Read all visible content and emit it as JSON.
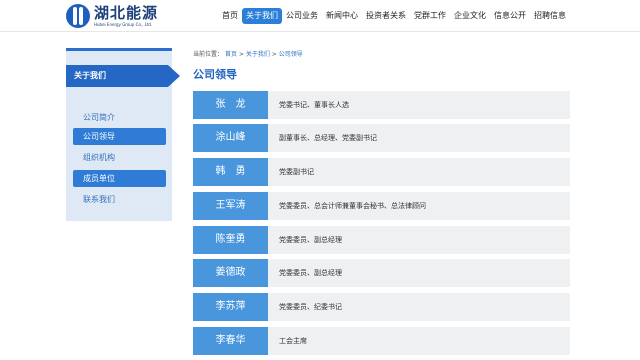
{
  "header": {
    "logo_cn": "湖北能源",
    "logo_en": "Hubei Energy Group Co., Ltd.",
    "nav": [
      {
        "label": "首页",
        "active": false
      },
      {
        "label": "关于我们",
        "active": true
      },
      {
        "label": "公司业务",
        "active": false
      },
      {
        "label": "新闻中心",
        "active": false
      },
      {
        "label": "投资者关系",
        "active": false
      },
      {
        "label": "党群工作",
        "active": false
      },
      {
        "label": "企业文化",
        "active": false
      },
      {
        "label": "信息公开",
        "active": false
      },
      {
        "label": "招聘信息",
        "active": false
      }
    ]
  },
  "sidebar": {
    "title": "关于我们",
    "items": [
      {
        "label": "公司简介",
        "active": false
      },
      {
        "label": "公司领导",
        "active": true
      },
      {
        "label": "组织机构",
        "active": false
      },
      {
        "label": "成员单位",
        "active": true
      },
      {
        "label": "联系我们",
        "active": false
      }
    ]
  },
  "breadcrumb": {
    "prefix": "当前位置：",
    "items": [
      "首页",
      "关于我们",
      "公司领导"
    ],
    "separator": " > "
  },
  "main": {
    "title": "公司领导",
    "leaders": [
      {
        "name": "张　龙",
        "position": "党委书记、董事长人选"
      },
      {
        "name": "涂山峰",
        "position": "副董事长、总经理、党委副书记"
      },
      {
        "name": "韩　勇",
        "position": "党委副书记"
      },
      {
        "name": "王军涛",
        "position": "党委委员、总会计师兼董事会秘书、总法律顾问"
      },
      {
        "name": "陈奎勇",
        "position": "党委委员、副总经理"
      },
      {
        "name": "姜德政",
        "position": "党委委员、副总经理"
      },
      {
        "name": "李苏萍",
        "position": "党委委员、纪委书记"
      },
      {
        "name": "李春华",
        "position": "工会主席"
      }
    ]
  },
  "colors": {
    "brand_blue": "#2567c4",
    "name_cell": "#4a96dd",
    "title_text": "#1f63c1",
    "row_bg": "#eef0f2",
    "sidebar_bg": "#dfe9f6"
  }
}
